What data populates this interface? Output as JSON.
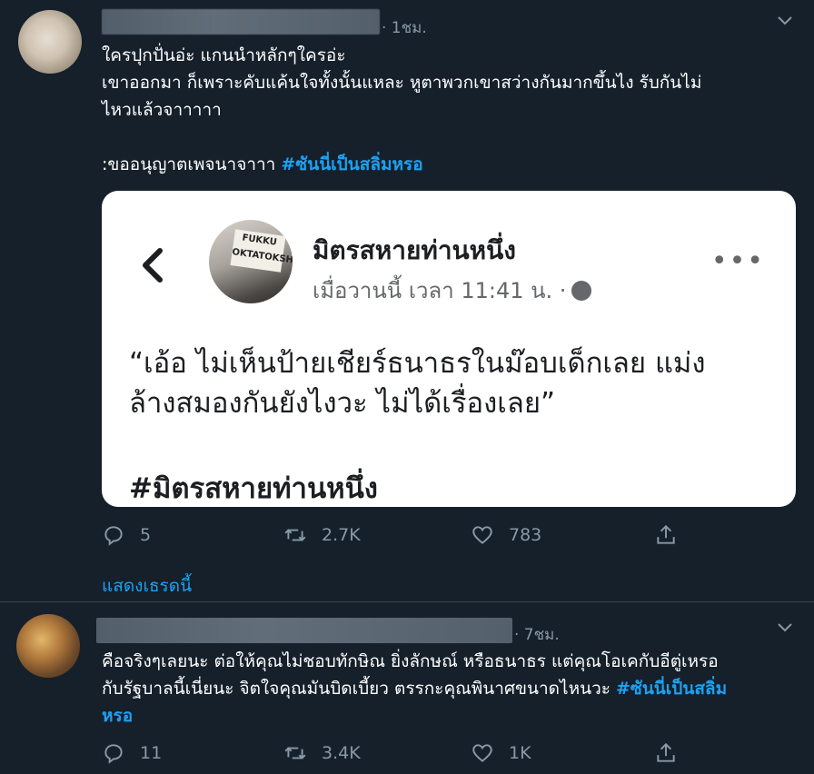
{
  "tweet1": {
    "time": "· 1ชม.",
    "text_lines": [
      "ใครปุกปั่นอ่ะ แกนนำหลักๆใครอ่ะ",
      "เขาออกมา ก็เพราะคับแค้นใจทั้งนั้นแหละ หูตาพวกเขาสว่างกันมากขึ้นไง รับกันไม่",
      "ไหวแล้วจาาาาา",
      "",
      ":ขออนุญาตเพจนาจาาา "
    ],
    "hashtag": "#ซันนี่เป็นสลิ่มหรอ",
    "card": {
      "sign_text": "FUKKU OKTATOKSHIP",
      "page_name": "มิตรสหายท่านหนึ่ง",
      "timestamp": "เมื่อวานนี้ เวลา 11:41 น. ·",
      "quote_line1": "“เอ้อ ไม่เห็นป้ายเชียร์ธนาธรในม๊อบเด็กเลย แม่ง",
      "quote_line2": "ล้างสมองกันยังไงวะ ไม่ได้เรื่องเลย”",
      "tag": "#มิตรสหายท่านหนึ่ง"
    },
    "replies": "5",
    "retweets": "2.7K",
    "likes": "783",
    "show_thread": "แสดงเธรดนี้"
  },
  "tweet2": {
    "time": "· 7ชม.",
    "text_line1": "คือจริงๆเลยนะ ต่อให้คุณไม่ชอบทักษิณ ยิ่งลักษณ์ หรือธนาธร แต่คุณโอเคกับอีตู่เหรอ",
    "text_line2": "กับรัฐบาลนี้เนี่ยนะ จิตใจคุณมันบิดเบี้ยว ตรรกะคุณพินาศขนาดไหนวะ ",
    "hashtag_part1": "#ซันนี่เป็นสลิ่ม",
    "hashtag_part2": "หรอ",
    "replies": "11",
    "retweets": "3.4K",
    "likes": "1K"
  },
  "colors": {
    "background": "#15202b",
    "accent": "#1da1f2",
    "muted": "#8899a6"
  },
  "icons": [
    "reply-icon",
    "retweet-icon",
    "like-icon",
    "share-icon",
    "chevron-down-icon",
    "back-arrow-icon",
    "globe-icon",
    "more-icon"
  ]
}
